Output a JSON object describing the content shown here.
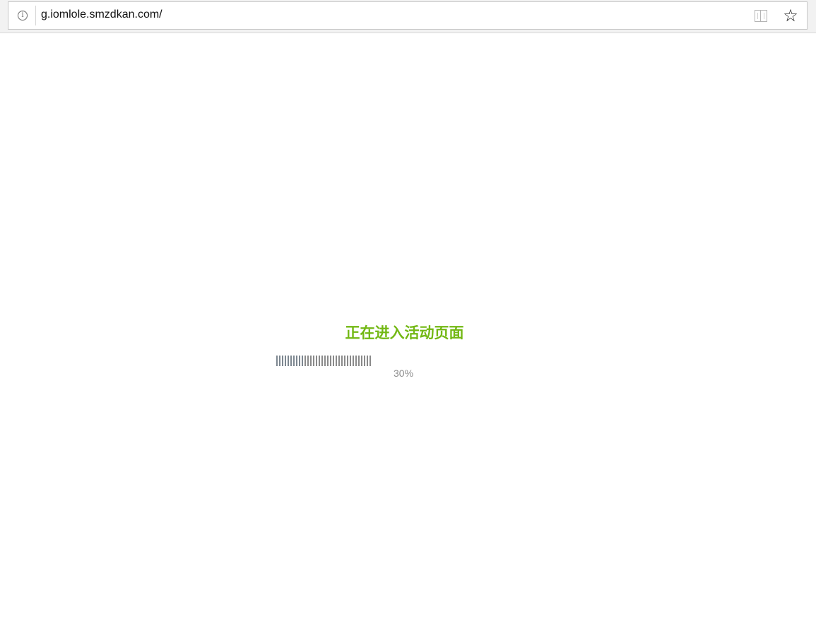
{
  "browser": {
    "url": "g.iomlole.smzdkan.com/",
    "site_info_icon": "info-icon",
    "reading_view_icon": "book-icon",
    "favorite_icon": "star-icon",
    "favorite_glyph": "☆",
    "info_glyph": "i"
  },
  "page": {
    "title": "正在进入活动页面",
    "progress_percent_text": "30%",
    "progress_value": 0.3,
    "title_color": "#73b814",
    "percent_color": "#8c8c8c"
  }
}
